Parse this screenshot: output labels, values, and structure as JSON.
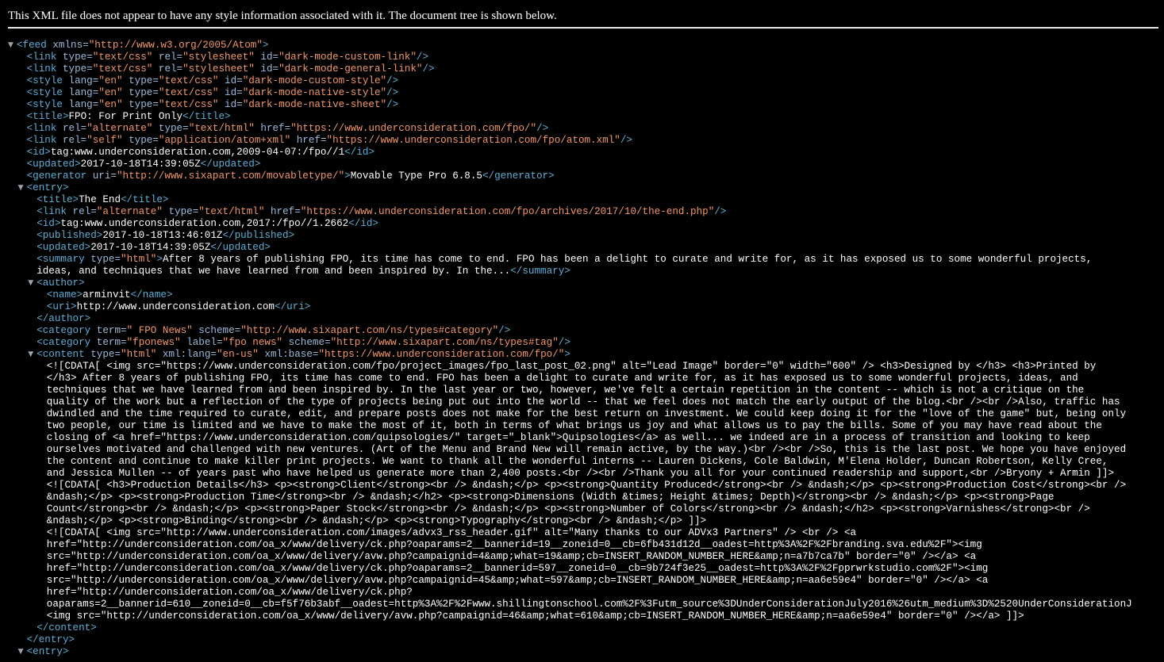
{
  "info_bar": "This XML file does not appear to have any style information associated with it. The document tree is shown below.",
  "colors": {
    "background": "#000000",
    "tag": "#5db0d7",
    "attribute_name": "#9bbbdc",
    "attribute_value": "#f29766",
    "text": "#ffffff",
    "toggle": "#9aa4ad"
  },
  "toggle_icon": "triangle-down-icon",
  "lines": [
    {
      "indent": 0,
      "toggle": true,
      "segments": [
        [
          "tag",
          "<feed"
        ],
        [
          "an",
          " xmlns="
        ],
        [
          "av",
          "\"http://www.w3.org/2005/Atom\""
        ],
        [
          "tag",
          ">"
        ]
      ]
    },
    {
      "indent": 1,
      "segments": [
        [
          "tag",
          "<link"
        ],
        [
          "an",
          " type="
        ],
        [
          "av",
          "\"text/css\""
        ],
        [
          "an",
          " rel="
        ],
        [
          "av",
          "\"stylesheet\""
        ],
        [
          "an",
          " id="
        ],
        [
          "av",
          "\"dark-mode-custom-link\""
        ],
        [
          "tag",
          "/>"
        ]
      ]
    },
    {
      "indent": 1,
      "segments": [
        [
          "tag",
          "<link"
        ],
        [
          "an",
          " type="
        ],
        [
          "av",
          "\"text/css\""
        ],
        [
          "an",
          " rel="
        ],
        [
          "av",
          "\"stylesheet\""
        ],
        [
          "an",
          " id="
        ],
        [
          "av",
          "\"dark-mode-general-link\""
        ],
        [
          "tag",
          "/>"
        ]
      ]
    },
    {
      "indent": 1,
      "segments": [
        [
          "tag",
          "<style"
        ],
        [
          "an",
          " lang="
        ],
        [
          "av",
          "\"en\""
        ],
        [
          "an",
          " type="
        ],
        [
          "av",
          "\"text/css\""
        ],
        [
          "an",
          " id="
        ],
        [
          "av",
          "\"dark-mode-custom-style\""
        ],
        [
          "tag",
          "/>"
        ]
      ]
    },
    {
      "indent": 1,
      "segments": [
        [
          "tag",
          "<style"
        ],
        [
          "an",
          " lang="
        ],
        [
          "av",
          "\"en\""
        ],
        [
          "an",
          " type="
        ],
        [
          "av",
          "\"text/css\""
        ],
        [
          "an",
          " id="
        ],
        [
          "av",
          "\"dark-mode-native-style\""
        ],
        [
          "tag",
          "/>"
        ]
      ]
    },
    {
      "indent": 1,
      "segments": [
        [
          "tag",
          "<style"
        ],
        [
          "an",
          " lang="
        ],
        [
          "av",
          "\"en\""
        ],
        [
          "an",
          " type="
        ],
        [
          "av",
          "\"text/css\""
        ],
        [
          "an",
          " id="
        ],
        [
          "av",
          "\"dark-mode-native-sheet\""
        ],
        [
          "tag",
          "/>"
        ]
      ]
    },
    {
      "indent": 1,
      "segments": [
        [
          "tag",
          "<title>"
        ],
        [
          "tx",
          "FPO: For Print Only"
        ],
        [
          "tag",
          "</title>"
        ]
      ]
    },
    {
      "indent": 1,
      "segments": [
        [
          "tag",
          "<link"
        ],
        [
          "an",
          " rel="
        ],
        [
          "av",
          "\"alternate\""
        ],
        [
          "an",
          " type="
        ],
        [
          "av",
          "\"text/html\""
        ],
        [
          "an",
          " href="
        ],
        [
          "av",
          "\"https://www.underconsideration.com/fpo/\""
        ],
        [
          "tag",
          "/>"
        ]
      ]
    },
    {
      "indent": 1,
      "segments": [
        [
          "tag",
          "<link"
        ],
        [
          "an",
          " rel="
        ],
        [
          "av",
          "\"self\""
        ],
        [
          "an",
          " type="
        ],
        [
          "av",
          "\"application/atom+xml\""
        ],
        [
          "an",
          " href="
        ],
        [
          "av",
          "\"https://www.underconsideration.com/fpo/atom.xml\""
        ],
        [
          "tag",
          "/>"
        ]
      ]
    },
    {
      "indent": 1,
      "segments": [
        [
          "tag",
          "<id>"
        ],
        [
          "tx",
          "tag:www.underconsideration.com,2009-04-07:/fpo//1"
        ],
        [
          "tag",
          "</id>"
        ]
      ]
    },
    {
      "indent": 1,
      "segments": [
        [
          "tag",
          "<updated>"
        ],
        [
          "tx",
          "2017-10-18T14:39:05Z"
        ],
        [
          "tag",
          "</updated>"
        ]
      ]
    },
    {
      "indent": 1,
      "segments": [
        [
          "tag",
          "<generator"
        ],
        [
          "an",
          " uri="
        ],
        [
          "av",
          "\"http://www.sixapart.com/movabletype/\""
        ],
        [
          "tag",
          ">"
        ],
        [
          "tx",
          "Movable Type Pro 6.8.5"
        ],
        [
          "tag",
          "</generator>"
        ]
      ]
    },
    {
      "indent": 1,
      "toggle": true,
      "segments": [
        [
          "tag",
          "<entry>"
        ]
      ]
    },
    {
      "indent": 2,
      "segments": [
        [
          "tag",
          "<title>"
        ],
        [
          "tx",
          "The End"
        ],
        [
          "tag",
          "</title>"
        ]
      ]
    },
    {
      "indent": 2,
      "segments": [
        [
          "tag",
          "<link"
        ],
        [
          "an",
          " rel="
        ],
        [
          "av",
          "\"alternate\""
        ],
        [
          "an",
          " type="
        ],
        [
          "av",
          "\"text/html\""
        ],
        [
          "an",
          " href="
        ],
        [
          "av",
          "\"https://www.underconsideration.com/fpo/archives/2017/10/the-end.php\""
        ],
        [
          "tag",
          "/>"
        ]
      ]
    },
    {
      "indent": 2,
      "segments": [
        [
          "tag",
          "<id>"
        ],
        [
          "tx",
          "tag:www.underconsideration.com,2017:/fpo//1.2662"
        ],
        [
          "tag",
          "</id>"
        ]
      ]
    },
    {
      "indent": 2,
      "segments": [
        [
          "tag",
          "<published>"
        ],
        [
          "tx",
          "2017-10-18T13:46:01Z"
        ],
        [
          "tag",
          "</published>"
        ]
      ]
    },
    {
      "indent": 2,
      "segments": [
        [
          "tag",
          "<updated>"
        ],
        [
          "tx",
          "2017-10-18T14:39:05Z"
        ],
        [
          "tag",
          "</updated>"
        ]
      ]
    },
    {
      "indent": 2,
      "segments": [
        [
          "tag",
          "<summary"
        ],
        [
          "an",
          " type="
        ],
        [
          "av",
          "\"html\""
        ],
        [
          "tag",
          ">"
        ],
        [
          "tx",
          "After 8 years of publishing FPO, its time has come to end. FPO has been a delight to curate and write for, as it has exposed us to some wonderful projects,"
        ]
      ]
    },
    {
      "indent": 2,
      "segments": [
        [
          "tx",
          "ideas, and techniques that we have learned from and been inspired by. In the..."
        ],
        [
          "tag",
          "</summary>"
        ]
      ]
    },
    {
      "indent": 2,
      "toggle": true,
      "segments": [
        [
          "tag",
          "<author>"
        ]
      ]
    },
    {
      "indent": 3,
      "segments": [
        [
          "tag",
          "<name>"
        ],
        [
          "tx",
          "arminvit"
        ],
        [
          "tag",
          "</name>"
        ]
      ]
    },
    {
      "indent": 3,
      "segments": [
        [
          "tag",
          "<uri>"
        ],
        [
          "tx",
          "http://www.underconsideration.com"
        ],
        [
          "tag",
          "</uri>"
        ]
      ]
    },
    {
      "indent": 2,
      "segments": [
        [
          "tag",
          "</author>"
        ]
      ]
    },
    {
      "indent": 2,
      "segments": [
        [
          "tag",
          "<category"
        ],
        [
          "an",
          " term="
        ],
        [
          "av",
          "\" FPO News\""
        ],
        [
          "an",
          " scheme="
        ],
        [
          "av",
          "\"http://www.sixapart.com/ns/types#category\""
        ],
        [
          "tag",
          "/>"
        ]
      ]
    },
    {
      "indent": 2,
      "segments": [
        [
          "tag",
          "<category"
        ],
        [
          "an",
          " term="
        ],
        [
          "av",
          "\"fponews\""
        ],
        [
          "an",
          " label="
        ],
        [
          "av",
          "\"fpo news\""
        ],
        [
          "an",
          " scheme="
        ],
        [
          "av",
          "\"http://www.sixapart.com/ns/types#tag\""
        ],
        [
          "tag",
          "/>"
        ]
      ]
    },
    {
      "indent": 2,
      "toggle": true,
      "segments": [
        [
          "tag",
          "<content"
        ],
        [
          "an",
          " type="
        ],
        [
          "av",
          "\"html\""
        ],
        [
          "an",
          " xml:lang="
        ],
        [
          "av",
          "\"en-us\""
        ],
        [
          "an",
          " xml:base="
        ],
        [
          "av",
          "\"https://www.underconsideration.com/fpo/\""
        ],
        [
          "tag",
          ">"
        ]
      ]
    },
    {
      "indent": 3,
      "segments": [
        [
          "tx",
          "<![CDATA[ <img src=\"https://www.underconsideration.com/fpo/project_images/fpo_last_post_02.png\" alt=\"Lead Image\" border=\"0\" width=\"600\" /> <h3>Designed by </h3> <h3>Printed by"
        ]
      ]
    },
    {
      "indent": 3,
      "segments": [
        [
          "tx",
          "</h3> After 8 years of publishing FPO, its time has come to end. FPO has been a delight to curate and write for, as it has exposed us to some wonderful projects, ideas, and"
        ]
      ]
    },
    {
      "indent": 3,
      "segments": [
        [
          "tx",
          "techniques that we have learned from and been inspired by. In the last year or two, however, we've felt a certain repetition in the content -- which is not a critique on the"
        ]
      ]
    },
    {
      "indent": 3,
      "segments": [
        [
          "tx",
          "quality of the work but a reflection of the type of projects being put out into the world -- that we feel does not match the early output of the blog.<br /><br />Also, traffic has"
        ]
      ]
    },
    {
      "indent": 3,
      "segments": [
        [
          "tx",
          "dwindled and the time required to curate, edit, and prepare posts does not make for the best return on investment. We could keep doing it for the \"love of the game\" but, being only"
        ]
      ]
    },
    {
      "indent": 3,
      "segments": [
        [
          "tx",
          "two people, our time is limited and we have to make the most of it, both in terms of what brings us joy and what allows us to pay the bills. Some of you may have read about the"
        ]
      ]
    },
    {
      "indent": 3,
      "segments": [
        [
          "tx",
          "closing of <a href=\"https://www.underconsideration.com/quipsologies/\" target=\"_blank\">Quipsologies</a> as well... we indeed are in a process of transition and looking to keep"
        ]
      ]
    },
    {
      "indent": 3,
      "segments": [
        [
          "tx",
          "ourselves motivated and challenged with new ventures. (Art of the Menu and Brand New will remain active, by the way.)<br /><br />So, this is the last post. We hope you have enjoyed"
        ]
      ]
    },
    {
      "indent": 3,
      "segments": [
        [
          "tx",
          "the content and continue to make killer print projects. We want to thank all the wonderful interns -- Lauren Dickens, Cole Baldwin, M'Elena Holder, Duncan Robertson, Kelly Cree,"
        ]
      ]
    },
    {
      "indent": 3,
      "segments": [
        [
          "tx",
          "and Jessica Mullen -- of years past who have helped us generate more than 2,400 posts.<br /><br />Thank you all for your continued readership and support,<br />Bryony + Armin ]]>"
        ]
      ]
    },
    {
      "indent": 3,
      "segments": [
        [
          "tx",
          "<![CDATA[ <h3>Production Details</h3> <p><strong>Client</strong><br /> &ndash;</p> <p><strong>Quantity Produced</strong><br /> &ndash;</p> <p><strong>Production Cost</strong><br />"
        ]
      ]
    },
    {
      "indent": 3,
      "segments": [
        [
          "tx",
          "&ndash;</p> <p><strong>Production Time</strong><br /> &ndash;</h2> <p><strong>Dimensions (Width &times; Height &times; Depth)</strong><br /> &ndash;</p> <p><strong>Page"
        ]
      ]
    },
    {
      "indent": 3,
      "segments": [
        [
          "tx",
          "Count</strong><br /> &ndash;</p> <p><strong>Paper Stock</strong><br /> &ndash;</p> <p><strong>Number of Colors</strong><br /> &ndash;</h2> <p><strong>Varnishes</strong><br />"
        ]
      ]
    },
    {
      "indent": 3,
      "segments": [
        [
          "tx",
          "&ndash;</p> <p><strong>Binding</strong><br /> &ndash;</p> <p><strong>Typography</strong><br /> &ndash;</p> ]]>"
        ]
      ]
    },
    {
      "indent": 3,
      "segments": [
        [
          "tx",
          "<![CDATA[ <img src=\"http://www.underconsideration.com/images/advx3_rss_header.gif\" alt=\"Many thanks to our ADVx3 Partners\" /> <br /> <a"
        ]
      ]
    },
    {
      "indent": 3,
      "segments": [
        [
          "tx",
          "href=\"http://underconsideration.com/oa_x/www/delivery/ck.php?oaparams=2__bannerid=19__zoneid=0__cb=6fb431d12d__oadest=http%3A%2F%2Fbranding.sva.edu%2F\"><img"
        ]
      ]
    },
    {
      "indent": 3,
      "segments": [
        [
          "tx",
          "src=\"http://underconsideration.com/oa_x/www/delivery/avw.php?campaignid=4&amp;what=19&amp;cb=INSERT_RANDOM_NUMBER_HERE&amp;n=a7b7ca7b\" border=\"0\" /></a> <a"
        ]
      ]
    },
    {
      "indent": 3,
      "segments": [
        [
          "tx",
          "href=\"http://underconsideration.com/oa_x/www/delivery/ck.php?oaparams=2__bannerid=597__zoneid=0__cb=9b724f3e25__oadest=http%3A%2F%2Fpprwrkstudio.com%2F\"><img"
        ]
      ]
    },
    {
      "indent": 3,
      "segments": [
        [
          "tx",
          "src=\"http://underconsideration.com/oa_x/www/delivery/avw.php?campaignid=45&amp;what=597&amp;cb=INSERT_RANDOM_NUMBER_HERE&amp;n=aa6e59e4\" border=\"0\" /></a> <a"
        ]
      ]
    },
    {
      "indent": 3,
      "segments": [
        [
          "tx",
          "href=\"http://underconsideration.com/oa_x/www/delivery/ck.php?"
        ]
      ]
    },
    {
      "indent": 3,
      "segments": [
        [
          "tx",
          "oaparams=2__bannerid=610__zoneid=0__cb=f5f76b3abf__oadest=http%3A%2F%2Fwww.shillingtonschool.com%2F%3Futm_source%3DUnderConsiderationJuly2016%26utm_medium%3D%2520UnderConsiderationJ"
        ]
      ]
    },
    {
      "indent": 3,
      "segments": [
        [
          "tx",
          "<img src=\"http://underconsideration.com/oa_x/www/delivery/avw.php?campaignid=46&amp;what=610&amp;cb=INSERT_RANDOM_NUMBER_HERE&amp;n=aa6e59e4\" border=\"0\" /></a> ]]>"
        ]
      ]
    },
    {
      "indent": 2,
      "segments": [
        [
          "tag",
          "</content>"
        ]
      ]
    },
    {
      "indent": 1,
      "segments": [
        [
          "tag",
          "</entry>"
        ]
      ]
    },
    {
      "indent": 1,
      "toggle": true,
      "segments": [
        [
          "tag",
          "<entry>"
        ]
      ]
    }
  ]
}
